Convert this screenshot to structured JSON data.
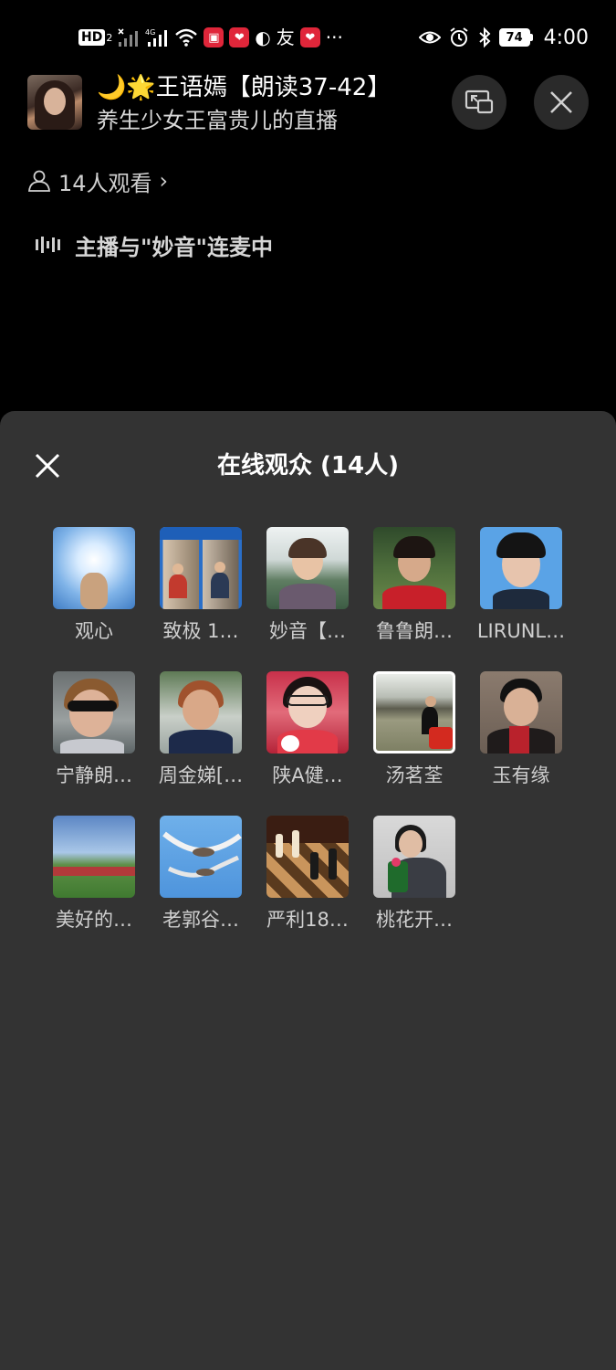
{
  "status_bar": {
    "left_icons": [
      "hd-icon",
      "signal-icon",
      "signal-4g-icon",
      "wifi-icon",
      "app-icon-1",
      "app-icon-2",
      "app-icon-3",
      "app-icon-4",
      "app-icon-5"
    ],
    "hd_label": "HD",
    "hd_sub": "2",
    "more_label": "···",
    "battery_level": "74",
    "time": "4:00"
  },
  "header": {
    "host_title": "🌙🌟王语嫣【朗读37-42】",
    "host_subtitle": "养生少女王富贵儿的直播",
    "viewer_count_label": "14人观看",
    "viewer_chevron": "›",
    "linkmic_label": "主播与\"妙音\"连麦中"
  },
  "sheet": {
    "title": "在线观众 (14人)",
    "audience": [
      {
        "name": "观心",
        "thumb": "light"
      },
      {
        "name": "致极  1…",
        "thumb": "collage"
      },
      {
        "name": "妙音【…",
        "thumb": "woman-park"
      },
      {
        "name": "鲁鲁朗…",
        "thumb": "woman-red"
      },
      {
        "name": "LIRUNL…",
        "thumb": "woman-blue"
      },
      {
        "name": "宁静朗…",
        "thumb": "sunglasses"
      },
      {
        "name": "周金娣[…",
        "thumb": "woman-dark"
      },
      {
        "name": "陕A健…",
        "thumb": "girl-red"
      },
      {
        "name": "汤茗荃",
        "thumb": "canal"
      },
      {
        "name": "玉有缘",
        "thumb": "woman-scarf"
      },
      {
        "name": "美好的…",
        "thumb": "meadow"
      },
      {
        "name": "老郭谷…",
        "thumb": "birds"
      },
      {
        "name": "严利18…",
        "thumb": "chess"
      },
      {
        "name": "桃花开…",
        "thumb": "woman-flower"
      }
    ]
  },
  "colors": {
    "background": "#000000",
    "sheet": "#333333",
    "secondary_text": "#cfcfcf",
    "badge_red": "#e0263a"
  }
}
